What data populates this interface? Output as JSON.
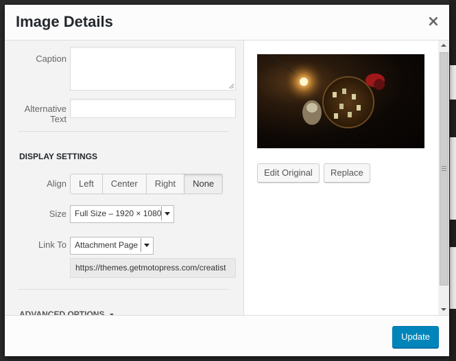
{
  "modal": {
    "title": "Image Details",
    "close_glyph": "×"
  },
  "fields": {
    "caption_label": "Caption",
    "caption_value": "",
    "alt_label_line1": "Alternative",
    "alt_label_line2": "Text",
    "alt_value": ""
  },
  "display_settings": {
    "heading": "DISPLAY SETTINGS",
    "align_label": "Align",
    "align_options": [
      "Left",
      "Center",
      "Right",
      "None"
    ],
    "align_selected": "None",
    "size_label": "Size",
    "size_value": "Full Size – 1920 × 1080",
    "link_label": "Link To",
    "link_value": "Attachment Page",
    "link_url": "https://themes.getmotopress.com/creatist"
  },
  "advanced": {
    "label": "ADVANCED OPTIONS",
    "arrow": "▼"
  },
  "preview": {
    "edit_label": "Edit Original",
    "replace_label": "Replace"
  },
  "footer": {
    "update_label": "Update"
  },
  "colors": {
    "primary_button": "#0085ba",
    "sidebar_bg": "#f3f3f3"
  },
  "icons": {
    "close": "close-icon",
    "dropdown": "chevron-down-icon",
    "advanced": "triangle-down-icon"
  }
}
